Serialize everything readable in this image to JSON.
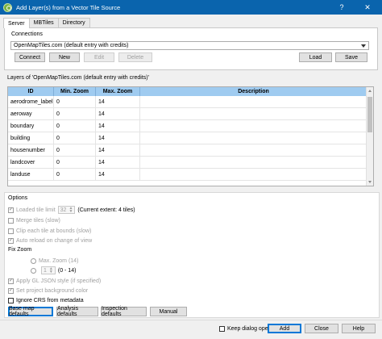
{
  "window": {
    "title": "Add Layer(s) from a Vector Tile Source",
    "help_glyph": "?",
    "close_glyph": "✕"
  },
  "tabs": [
    {
      "label": "Server",
      "active": true
    },
    {
      "label": "MBTiles",
      "active": false
    },
    {
      "label": "Directory",
      "active": false
    }
  ],
  "connections": {
    "group_label": "Connections",
    "selected": "OpenMapTiles.com (default entry with credits)",
    "buttons": {
      "connect": "Connect",
      "new": "New",
      "edit": "Edit",
      "delete": "Delete",
      "load": "Load",
      "save": "Save"
    }
  },
  "layers": {
    "label": "Layers of 'OpenMapTiles.com (default entry with credits)'",
    "columns": [
      "ID",
      "Min. Zoom",
      "Max. Zoom",
      "Description"
    ],
    "rows": [
      {
        "id": "aerodrome_label",
        "min": "0",
        "max": "14",
        "desc": ""
      },
      {
        "id": "aeroway",
        "min": "0",
        "max": "14",
        "desc": ""
      },
      {
        "id": "boundary",
        "min": "0",
        "max": "14",
        "desc": ""
      },
      {
        "id": "building",
        "min": "0",
        "max": "14",
        "desc": ""
      },
      {
        "id": "housenumber",
        "min": "0",
        "max": "14",
        "desc": ""
      },
      {
        "id": "landcover",
        "min": "0",
        "max": "14",
        "desc": ""
      },
      {
        "id": "landuse",
        "min": "0",
        "max": "14",
        "desc": ""
      }
    ]
  },
  "options": {
    "group_label": "Options",
    "loaded_tile_limit": "Loaded tile limit",
    "tile_limit_value": "32",
    "current_extent": "(Current extent: 4 tiles)",
    "merge_tiles": "Merge tiles (slow)",
    "clip_tiles": "Clip each tile at bounds (slow)",
    "auto_reload": "Auto reload on change of view",
    "fix_zoom": "Fix Zoom",
    "max_zoom": "Max. Zoom (14)",
    "zoom_value": "1",
    "zoom_range": "(0 - 14)",
    "apply_gl": "Apply GL JSON style (if specified)",
    "set_bg": "Set project background color",
    "ignore_crs": "Ignore CRS from metadata"
  },
  "presets": {
    "base": "Base map defaults",
    "analysis": "Analysis defaults",
    "inspection": "Inspection defaults",
    "manual": "Manual"
  },
  "footer": {
    "keep_open": "Keep dialog open",
    "add": "Add",
    "close": "Close",
    "help": "Help"
  }
}
